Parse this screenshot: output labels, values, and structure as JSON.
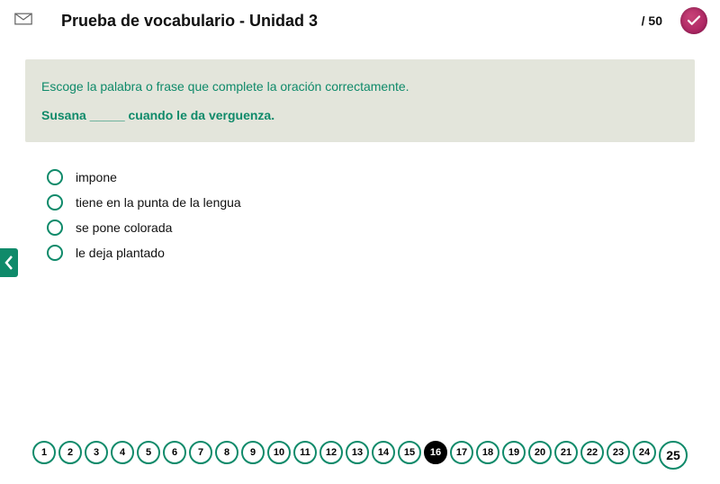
{
  "header": {
    "title": "Prueba de vocabulario - Unidad 3",
    "score_label": "/ 50"
  },
  "question": {
    "instruction": "Escoge la palabra o frase que complete la oración correctamente.",
    "sentence": "Susana _____ cuando le da verguenza."
  },
  "options": [
    {
      "label": "impone"
    },
    {
      "label": "tiene en la punta de la lengua"
    },
    {
      "label": "se pone colorada"
    },
    {
      "label": "le deja plantado"
    }
  ],
  "pager": {
    "items": [
      "1",
      "2",
      "3",
      "4",
      "5",
      "6",
      "7",
      "8",
      "9",
      "10",
      "11",
      "12",
      "13",
      "14",
      "15",
      "16",
      "17",
      "18",
      "19",
      "20",
      "21",
      "22",
      "23",
      "24"
    ],
    "current": "16",
    "next": "25"
  }
}
